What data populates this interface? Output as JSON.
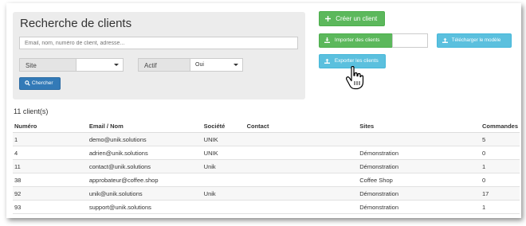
{
  "search_panel": {
    "title": "Recherche de clients",
    "search_placeholder": "Email, nom, numéro de client, adresse...",
    "site_label": "Site",
    "site_value": "",
    "active_label": "Actif",
    "active_value": "Oui",
    "search_button": "Chercher"
  },
  "actions": {
    "create_client": "Créer un client",
    "import_clients": "Importer des clients",
    "download_template": "Télécharger le modèle",
    "export_clients": "Exporter les clients"
  },
  "results": {
    "count_text": "11 client(s)",
    "columns": [
      "Numéro",
      "Email / Nom",
      "Société",
      "Contact",
      "Sites",
      "Commandes"
    ],
    "rows": [
      [
        "1",
        "demo@unik.solutions",
        "UNIK",
        "",
        "",
        "5"
      ],
      [
        "4",
        "adrien@unik.solutions",
        "UNIK",
        "",
        "Démonstration",
        "0"
      ],
      [
        "11",
        "contact@unik.solutions",
        "Unik",
        "",
        "Démonstration",
        "1"
      ],
      [
        "38",
        "approbateur@coffee.shop",
        "",
        "",
        "Coffee Shop",
        "0"
      ],
      [
        "92",
        "unik@unik.solutions",
        "Unik",
        "",
        "Démonstration",
        "17"
      ],
      [
        "93",
        "support@unik.solutions",
        "",
        "",
        "Démonstration",
        "1"
      ]
    ]
  },
  "colors": {
    "primary": "#337ab7",
    "success": "#5cb85c",
    "info": "#5bc0de",
    "panel": "#ececec"
  }
}
